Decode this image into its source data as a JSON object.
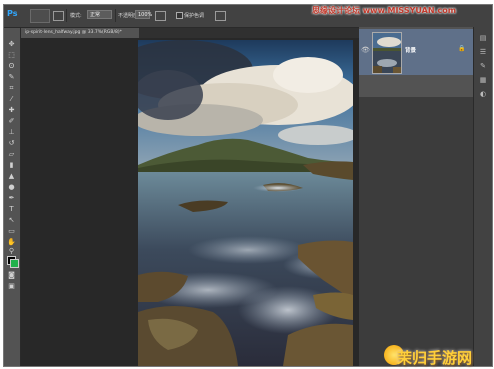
{
  "app": {
    "logo": "Ps"
  },
  "options_bar": {
    "mode_label": "模式:",
    "mode_value": "正常",
    "opacity_label": "不透明度:",
    "opacity_value": "100%",
    "preserve_label": "保护色调"
  },
  "document": {
    "tab_title": "ip-spirit-lens_halfway.jpg @ 33.7%(RGB/8)*"
  },
  "layers": {
    "layer_name": "背景"
  },
  "watermarks": {
    "top": "思缘设计论坛 www.MISSYUAN.com",
    "bottom": "茉归手游网"
  },
  "colors": {
    "foreground": "#000000",
    "background": "#22b14c",
    "layer_highlight": "#5f7089"
  }
}
